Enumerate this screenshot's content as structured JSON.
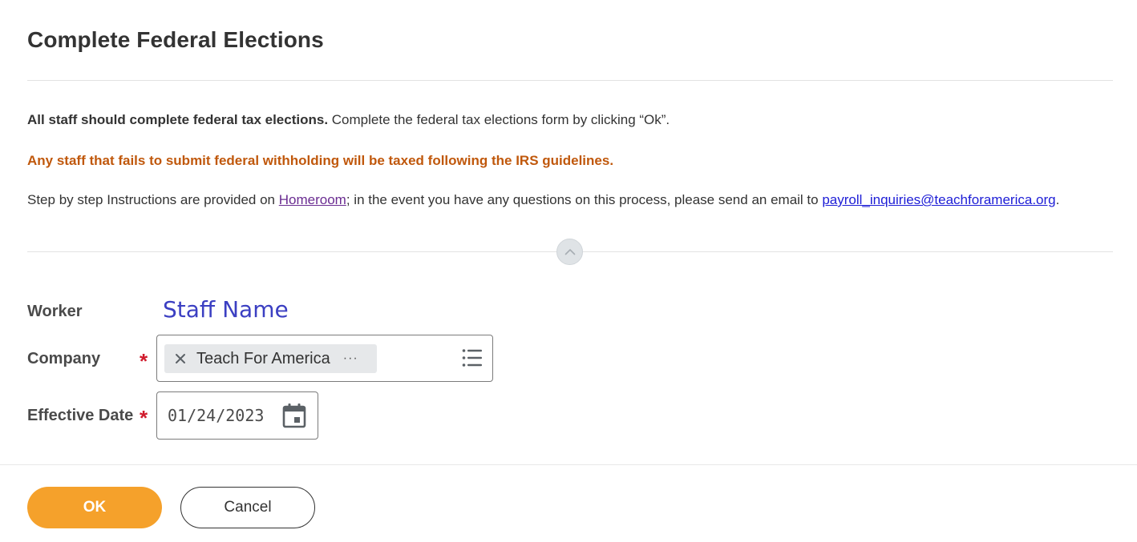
{
  "page": {
    "title": "Complete Federal Elections"
  },
  "instructions": {
    "line1_bold": "All staff should complete federal tax elections.",
    "line1_rest": " Complete the federal tax elections form by clicking “Ok”.",
    "warning": "Any staff that fails to submit federal withholding will be taxed following the IRS guidelines.",
    "line3_prefix": "Step by step Instructions are provided on ",
    "homeroom_link": "Homeroom",
    "line3_middle": "; in the event you have any questions on this process, please send an email to ",
    "email_link": "payroll_inquiries@teachforamerica.org",
    "line3_suffix": "."
  },
  "form": {
    "worker_label": "Worker",
    "worker_value": "Staff Name",
    "company_label": "Company",
    "company_value": "Teach For America",
    "company_more": "···",
    "date_label": "Effective Date",
    "date_value": "01/24/2023",
    "required_mark": "*"
  },
  "actions": {
    "ok_label": "OK",
    "cancel_label": "Cancel"
  },
  "icons": {
    "collapse": "chevron-up-icon",
    "remove": "close-icon",
    "prompt": "list-icon",
    "calendar": "calendar-icon"
  },
  "colors": {
    "primary_button": "#f5a12b",
    "warning_text": "#c0580c",
    "required": "#d01a2c",
    "worker_value": "#3b3fc2"
  }
}
